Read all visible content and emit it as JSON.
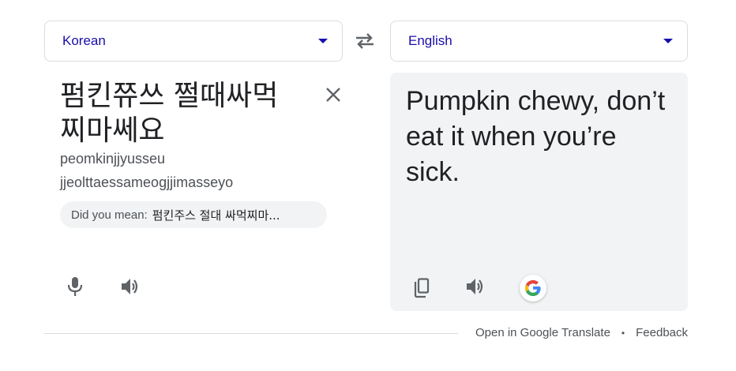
{
  "source": {
    "language": "Korean",
    "text": "펌킨쮸쓰 쩔때싸먹 찌마쎄요",
    "romanization": [
      "peomkinjjyusseu",
      "jjeolttaessameogjjimasseyo"
    ],
    "did_you_mean_prefix": "Did you mean:",
    "did_you_mean_value": "펌킨주스 절대 싸먹찌마..."
  },
  "target": {
    "language": "English",
    "text": "Pumpkin chewy, don’t eat it when you’re sick."
  },
  "footer": {
    "open_link": "Open in Google Translate",
    "separator": "•",
    "feedback_link": "Feedback"
  },
  "colors": {
    "link": "#1a0dab",
    "icon": "#5f6368",
    "panel": "#f1f3f4",
    "border": "#dadce0"
  },
  "icons": [
    "chevron-down-icon",
    "swap-icon",
    "close-icon",
    "microphone-icon",
    "speaker-icon",
    "copy-icon",
    "google-g-icon"
  ]
}
